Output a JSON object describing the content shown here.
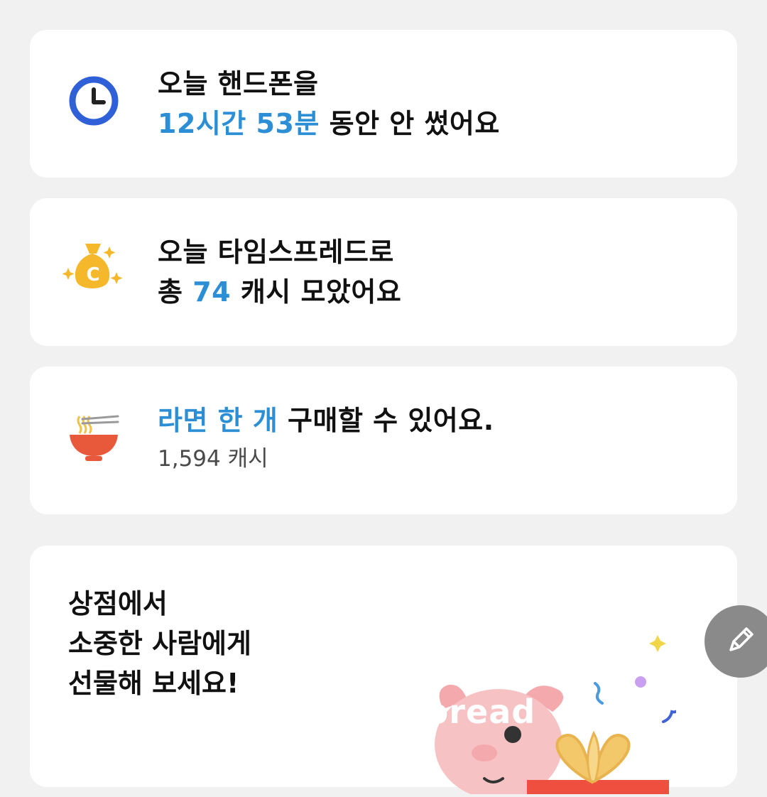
{
  "cards": {
    "screen_time": {
      "line1": "오늘 핸드폰을",
      "highlight": "12시간 53분",
      "line2_rest": " 동안 안 썼어요",
      "icon": "clock-icon"
    },
    "cash_total": {
      "line1": "오늘 타임스프레드로",
      "prefix": "총 ",
      "highlight": "74",
      "line2_rest": " 캐시 모았어요",
      "icon": "money-bag-icon"
    },
    "ramen": {
      "highlight": "라면 한 개",
      "line1_rest": " 구매할 수 있어요.",
      "sub": "1,594 캐시",
      "icon": "ramen-bowl-icon"
    },
    "shop_promo": {
      "lines": [
        "상점에서",
        "소중한 사람에게",
        "선물해 보세요!"
      ],
      "illustration": "pig-with-gift-illustration"
    }
  },
  "fab": {
    "icon": "pencil-icon"
  },
  "watermark": "spread",
  "colors": {
    "accent": "#2c8fd6",
    "card_bg": "#ffffff",
    "page_bg": "#f1f1f1",
    "clock_blue": "#3060d8",
    "coin_gold": "#f5b82a",
    "ramen_red": "#e8583a",
    "pig_pink": "#f7c2c4",
    "gift_red": "#ee4f3e"
  }
}
